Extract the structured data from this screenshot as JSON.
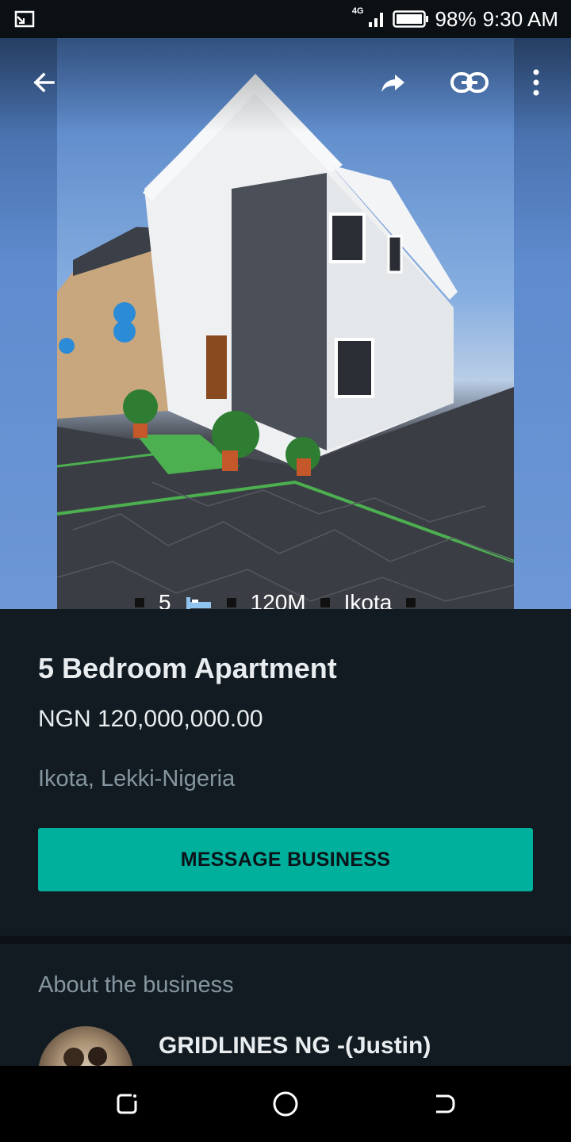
{
  "status_bar": {
    "network": "4G",
    "battery": "98%",
    "time": "9:30 AM"
  },
  "toolbar": {
    "back_icon": "arrow-left-icon",
    "share_icon": "forward-share-icon",
    "link_icon": "link-icon",
    "menu_icon": "more-vertical-icon"
  },
  "photo": {
    "caption_beds": "5",
    "caption_price": "120M",
    "caption_location": "Ikota"
  },
  "product": {
    "title": "5 Bedroom Apartment",
    "price": "NGN 120,000,000.00",
    "location": "Ikota, Lekki-Nigeria",
    "message_button": "MESSAGE BUSINESS"
  },
  "about": {
    "heading": "About the business",
    "business_name": "GRIDLINES NG -(Justin)"
  },
  "colors": {
    "accent": "#00af9c",
    "background": "#111b21",
    "muted_text": "#8696a0"
  }
}
